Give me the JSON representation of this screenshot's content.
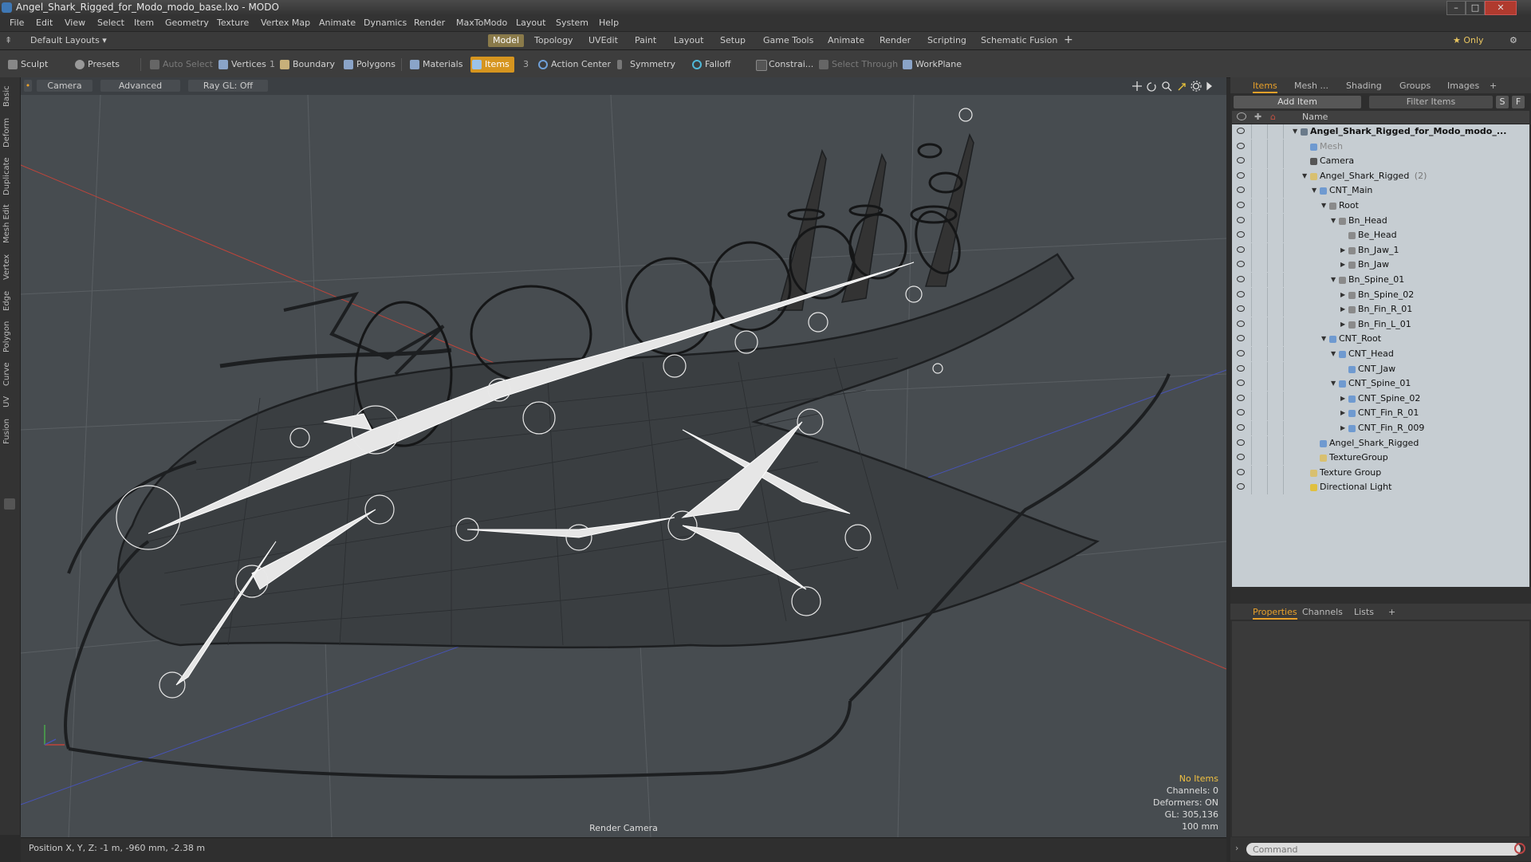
{
  "window": {
    "title": "Angel_Shark_Rigged_for_Modo_modo_base.lxo - MODO",
    "controls": [
      "–",
      "□",
      "✕"
    ]
  },
  "menu": [
    "File",
    "Edit",
    "View",
    "Select",
    "Item",
    "Geometry",
    "Texture",
    "Vertex Map",
    "Animate",
    "Dynamics",
    "Render",
    "MaxToModo",
    "Layout",
    "System",
    "Help"
  ],
  "layoutbar": {
    "layout_select": "Default Layouts ▾",
    "tabs": [
      "Model",
      "Topology",
      "UVEdit",
      "Paint",
      "Layout",
      "Setup",
      "Game Tools",
      "Animate",
      "Render",
      "Scripting",
      "Schematic Fusion"
    ],
    "active_tab": "Model",
    "add": "+",
    "only": "★ Only",
    "gear": "⚙"
  },
  "toolbar": {
    "sculpt": "Sculpt",
    "presets": "Presets",
    "auto_select": "Auto Select",
    "vertices": "Vertices",
    "vertices_count": "1",
    "boundary": "Boundary",
    "polygons": "Polygons",
    "materials": "Materials",
    "items": "Items",
    "items_count": "3",
    "action_center": "Action Center",
    "symmetry": "Symmetry",
    "falloff": "Falloff",
    "constrain": "Constrai...",
    "select_through": "Select Through",
    "workplane": "WorkPlane"
  },
  "left_tabs": [
    "Basic",
    "Deform",
    "Duplicate",
    "Mesh Edit",
    "Vertex",
    "Edge",
    "Polygon",
    "Curve",
    "UV",
    "Fusion"
  ],
  "viewport": {
    "camera": "Camera",
    "advanced": "Advanced",
    "raygl": "Ray GL: Off",
    "info": {
      "no_items": "No Items",
      "channels": "Channels: 0",
      "deformers": "Deformers: ON",
      "gl": "GL: 305,136",
      "scale": "100 mm"
    },
    "render_camera": "Render Camera",
    "icons": [
      "move-icon",
      "rotate-icon",
      "zoom-icon",
      "maximize-icon",
      "gear-icon",
      "arrow-icon"
    ]
  },
  "status": {
    "position": "Position X, Y, Z:  -1 m, -960 mm, -2.38 m"
  },
  "panel": {
    "tabs": [
      "Items",
      "Mesh ...",
      "Shading",
      "Groups",
      "Images",
      "+"
    ],
    "active_tab": "Items",
    "add_item": "Add Item",
    "filter": "Filter Items",
    "s_btn": "S",
    "f_btn": "F",
    "name_header": "Name",
    "tree": [
      {
        "label": "Angel_Shark_Rigged_for_Modo_modo_...",
        "depth": 0,
        "bold": true,
        "expand": "▼",
        "icon": "scene"
      },
      {
        "label": "Mesh",
        "depth": 1,
        "grey": true,
        "icon": "mesh"
      },
      {
        "label": "Camera",
        "depth": 1,
        "icon": "camera"
      },
      {
        "label": "Angel_Shark_Rigged",
        "suffix": " (2)",
        "depth": 1,
        "expand": "▼",
        "icon": "group"
      },
      {
        "label": "CNT_Main",
        "depth": 2,
        "expand": "▼",
        "icon": "mesh"
      },
      {
        "label": "Root",
        "depth": 3,
        "expand": "▼",
        "icon": "bone"
      },
      {
        "label": "Bn_Head",
        "depth": 4,
        "expand": "▼",
        "icon": "bone"
      },
      {
        "label": "Be_Head",
        "depth": 5,
        "icon": "bone"
      },
      {
        "label": "Bn_Jaw_1",
        "depth": 5,
        "expand": "▶",
        "icon": "bone"
      },
      {
        "label": "Bn_Jaw",
        "depth": 5,
        "expand": "▶",
        "icon": "bone"
      },
      {
        "label": "Bn_Spine_01",
        "depth": 4,
        "expand": "▼",
        "icon": "bone"
      },
      {
        "label": "Bn_Spine_02",
        "depth": 5,
        "expand": "▶",
        "icon": "bone"
      },
      {
        "label": "Bn_Fin_R_01",
        "depth": 5,
        "expand": "▶",
        "icon": "bone"
      },
      {
        "label": "Bn_Fin_L_01",
        "depth": 5,
        "expand": "▶",
        "icon": "bone"
      },
      {
        "label": "CNT_Root",
        "depth": 3,
        "expand": "▼",
        "icon": "mesh"
      },
      {
        "label": "CNT_Head",
        "depth": 4,
        "expand": "▼",
        "icon": "mesh"
      },
      {
        "label": "CNT_Jaw",
        "depth": 5,
        "icon": "mesh"
      },
      {
        "label": "CNT_Spine_01",
        "depth": 4,
        "expand": "▼",
        "icon": "mesh"
      },
      {
        "label": "CNT_Spine_02",
        "depth": 5,
        "expand": "▶",
        "icon": "mesh"
      },
      {
        "label": "CNT_Fin_R_01",
        "depth": 5,
        "expand": "▶",
        "icon": "mesh"
      },
      {
        "label": "CNT_Fin_R_009",
        "depth": 5,
        "expand": "▶",
        "icon": "mesh"
      },
      {
        "label": "Angel_Shark_Rigged",
        "depth": 2,
        "icon": "mesh"
      },
      {
        "label": "TextureGroup",
        "depth": 2,
        "icon": "group"
      },
      {
        "label": "Texture Group",
        "depth": 1,
        "icon": "group"
      },
      {
        "label": "Directional Light",
        "depth": 1,
        "icon": "light"
      }
    ],
    "bottom_tabs": [
      "Properties",
      "Channels",
      "Lists",
      "+"
    ],
    "bottom_active": "Properties",
    "command_placeholder": "Command"
  },
  "colors": {
    "accent": "#e8a02a",
    "items_highlight": "#d6951f",
    "viewport_bg": "#4a4f53",
    "tree_bg": "#c6cdd2"
  }
}
